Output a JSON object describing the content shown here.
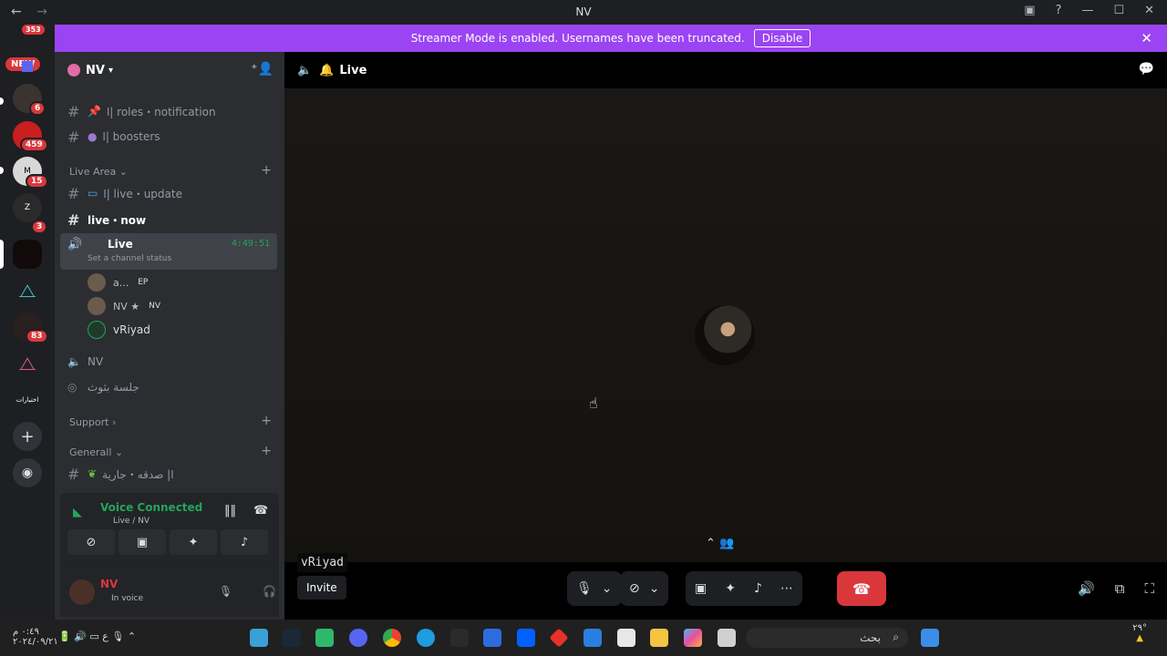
{
  "window": {
    "title": "NV",
    "back": "←",
    "forward": "→"
  },
  "guild_rail": {
    "new_badge": "NEW",
    "mention_count": "353",
    "badges": [
      "6",
      "459",
      "15",
      "3",
      "83"
    ],
    "folder_label": "اختيارات"
  },
  "banner": {
    "text": "Streamer Mode is enabled. Usernames have been truncated.",
    "disable": "Disable"
  },
  "server": {
    "name": "NV"
  },
  "channels": {
    "roles": "ا| roles・notification",
    "boosters": "ا| boosters",
    "live_area": "Live Area",
    "live_update": "ا| live・update",
    "live_now": "live・now",
    "live_voice": "Live",
    "live_timer": "4:49:51",
    "set_status": "Set a channel status",
    "nv_voice": "NV",
    "arabic_voice": "جلسة بثوث",
    "support": "Support",
    "generall": "Generall",
    "sadaqa": "ا| صدقه・جارية"
  },
  "voice_users": [
    {
      "name": "a...",
      "tag": "EP"
    },
    {
      "name": "NV ★",
      "tag": "NV"
    },
    {
      "name": "vRiyad",
      "tag": ""
    }
  ],
  "voice_panel": {
    "status": "Voice Connected",
    "location": "Live / NV"
  },
  "user_panel": {
    "name": "NV",
    "status": "In voice"
  },
  "stage": {
    "channel": "Live",
    "name_tag": "vRiyad",
    "invite": "Invite"
  },
  "taskbar": {
    "time": "٠:٤٩ م",
    "date": "٢٠٢٤/٠٩/٢١",
    "search_placeholder": "بحث",
    "weather": "٢٩°"
  },
  "colors": {
    "accent": "#9b44f3",
    "danger": "#da373c",
    "online": "#23a55a"
  }
}
